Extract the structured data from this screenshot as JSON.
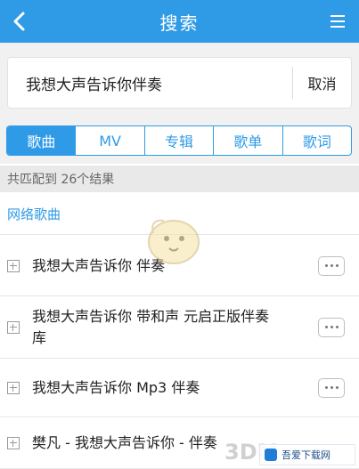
{
  "header": {
    "title": "搜索"
  },
  "search": {
    "query": "我想大声告诉你伴奏",
    "cancel_label": "取消"
  },
  "tabs": [
    {
      "label": "歌曲",
      "active": true
    },
    {
      "label": "MV",
      "active": false
    },
    {
      "label": "专辑",
      "active": false
    },
    {
      "label": "歌单",
      "active": false
    },
    {
      "label": "歌词",
      "active": false
    }
  ],
  "result_count": "共匹配到 26个结果",
  "section_title": "网络歌曲",
  "songs": [
    {
      "title": "我想大声告诉你 伴奏"
    },
    {
      "title": "我想大声告诉你 带和声 元启正版伴奏库"
    },
    {
      "title": "我想大声告诉你 Mp3 伴奏"
    },
    {
      "title": "樊凡 - 我想大声告诉你 - 伴奏"
    }
  ],
  "brand": {
    "name": "吾爱下载网"
  },
  "watermark_text": "3DM",
  "icons": {
    "back": "chevron-left-icon",
    "menu": "menu-icon",
    "expand": "plus-box-icon",
    "more": "more-dots-icon"
  },
  "colors": {
    "accent": "#2f9be6",
    "section_title": "#2f9be6",
    "count_bg": "#e9e9e9"
  }
}
